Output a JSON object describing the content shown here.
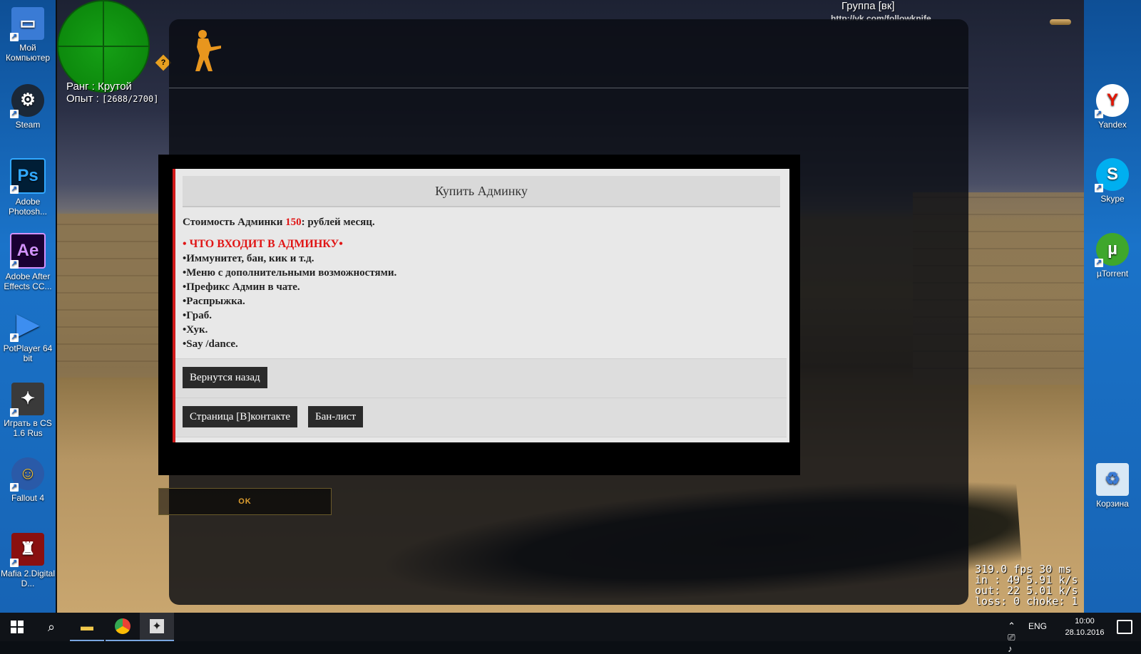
{
  "desktop_left": [
    {
      "label": "Мой Компьютер",
      "icon": "computer-icon",
      "color": "#3a7bd5"
    },
    {
      "label": "Steam",
      "icon": "steam-icon",
      "color": "#1b2838"
    },
    {
      "label": "Adobe Photosh...",
      "icon": "photoshop-icon",
      "color": "#001e36"
    },
    {
      "label": "Adobe After Effects CC...",
      "icon": "after-effects-icon",
      "color": "#1a0033"
    },
    {
      "label": "PotPlayer 64 bit",
      "icon": "potplayer-icon",
      "color": "#2a6fd6"
    },
    {
      "label": "Играть в CS 1.6 Rus",
      "icon": "counter-strike-icon",
      "color": "#3a3a3a"
    },
    {
      "label": "Fallout 4",
      "icon": "fallout-icon",
      "color": "#2a5aa8"
    },
    {
      "label": "Mafia 2.Digital D...",
      "icon": "mafia-icon",
      "color": "#8a1010"
    }
  ],
  "desktop_right": [
    {
      "label": "Yandex",
      "icon": "yandex-icon",
      "color": "#ffffff"
    },
    {
      "label": "Skype",
      "icon": "skype-icon",
      "color": "#00aff0"
    },
    {
      "label": "µTorrent",
      "icon": "utorrent-icon",
      "color": "#3fa72c"
    },
    {
      "label": "Корзина",
      "icon": "recycle-bin-icon",
      "color": "#d8e8f5"
    }
  ],
  "hud": {
    "rank": "Ранг : Крутой",
    "exp_label": "Опыт : ",
    "exp_value": "[2688/2700]",
    "group_title": "Группа [вк]",
    "group_url": "http://vk.com/followknife"
  },
  "dialog": {
    "title": "Купить Админку",
    "cost_prefix": "Стоимость Админки ",
    "cost_value": "150",
    "cost_suffix": ": рублей месяц.",
    "features_heading": "• ЧТО ВХОДИТ В АДМИНКУ•",
    "features": [
      "•Иммунитет, бан, кик и т.д.",
      "•Меню с дополнительными возможностями.",
      "•Префикс Админ в чате.",
      "•Распрыжка.",
      "•Граб.",
      "•Хук.",
      "•Say /dance."
    ],
    "back_button": "Вернутся назад",
    "vk_button": "Страница [В]контакте",
    "banlist_button": "Бан-лист",
    "accent": "#e01515"
  },
  "ok_button": "OK",
  "netstats": {
    "line1": "319.0 fps 30 ms",
    "line2": "in : 49 5.91 k/s",
    "line3": "out: 22 5.01 k/s",
    "line4": "loss: 0 choke: 1"
  },
  "taskbar": {
    "lang": "ENG",
    "time": "10:00",
    "date": "28.10.2016"
  }
}
